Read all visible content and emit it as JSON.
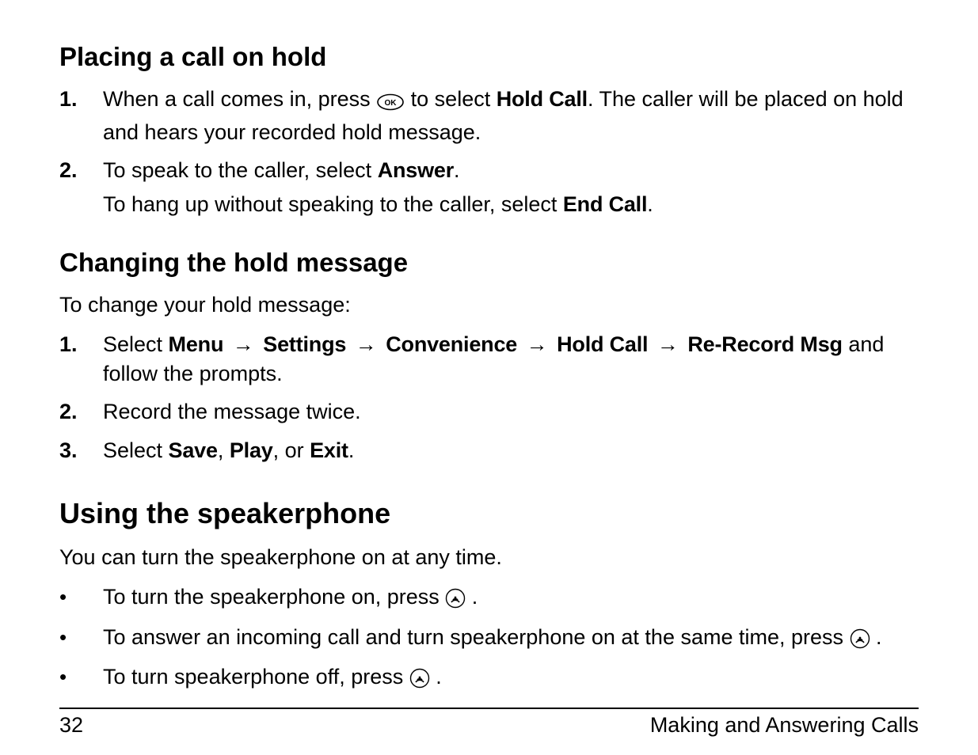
{
  "sections": {
    "hold": {
      "title": "Placing a call on hold",
      "steps": {
        "s1": {
          "num": "1.",
          "pre": "When a call comes in, press ",
          "mid": " to select ",
          "bold1": "Hold Call",
          "post": ". The caller will be placed on hold and hears your recorded hold message."
        },
        "s2": {
          "num": "2.",
          "line1_pre": "To speak to the caller, select ",
          "line1_bold": "Answer",
          "line1_post": ".",
          "line2_pre": "To hang up without speaking to the caller, select ",
          "line2_bold": "End Call",
          "line2_post": "."
        }
      }
    },
    "change": {
      "title": "Changing the hold message",
      "intro": "To change your hold message:",
      "steps": {
        "s1": {
          "num": "1.",
          "pre": "Select ",
          "m1": "Menu",
          "m2": "Settings",
          "m3": "Convenience",
          "m4": "Hold Call",
          "m5": "Re-Record Msg",
          "post": " and follow the prompts."
        },
        "s2": {
          "num": "2.",
          "text": "Record the message twice."
        },
        "s3": {
          "num": "3.",
          "pre": "Select ",
          "b1": "Save",
          "sep1": ", ",
          "b2": "Play",
          "sep2": ", or ",
          "b3": "Exit",
          "post": "."
        }
      },
      "arrow": "→"
    },
    "speaker": {
      "title": "Using the speakerphone",
      "intro": "You can turn the speakerphone on at any time.",
      "bullets": {
        "b1": {
          "pre": "To turn the speakerphone on, press ",
          "post": "."
        },
        "b2": {
          "pre": "To answer an incoming call and turn speakerphone on at the same time, press ",
          "post": "."
        },
        "b3": {
          "pre": "To turn speakerphone off, press ",
          "post": "."
        }
      }
    }
  },
  "footer": {
    "page": "32",
    "chapter": "Making and Answering Calls"
  },
  "bullet_char": "•"
}
